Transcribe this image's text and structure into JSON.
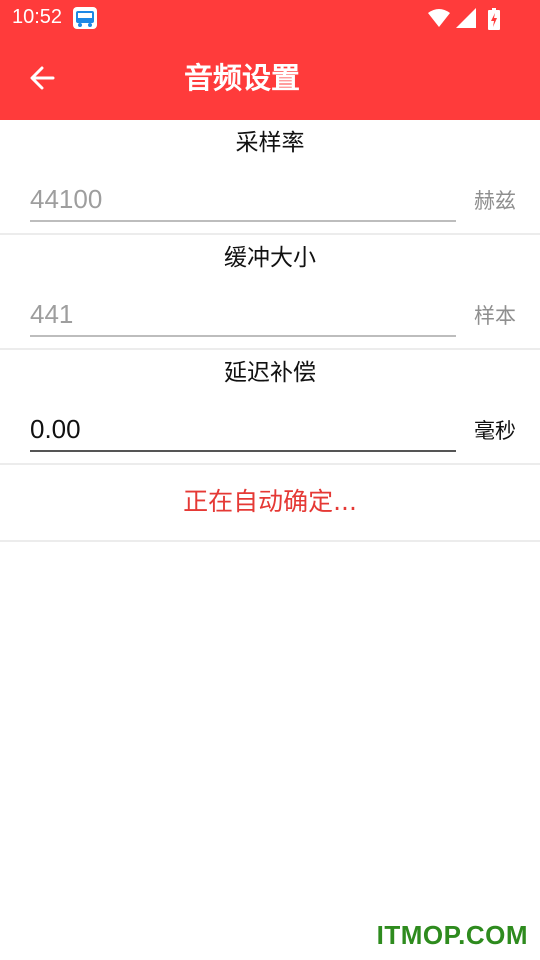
{
  "status_bar": {
    "time": "10:52"
  },
  "app_bar": {
    "title": "音频设置"
  },
  "settings": [
    {
      "label": "采样率",
      "value": "44100",
      "unit": "赫兹"
    },
    {
      "label": "缓冲大小",
      "value": "441",
      "unit": "样本"
    },
    {
      "label": "延迟补偿",
      "value": "0.00",
      "unit": "毫秒"
    }
  ],
  "auto_detect": {
    "text": "正在自动确定..."
  },
  "watermark": "ITMOP.COM",
  "colors": {
    "accent": "#ff3b3b",
    "auto_text": "#e53935",
    "watermark": "#2e8b1e"
  },
  "icons": [
    "back-arrow-icon",
    "wifi-icon",
    "signal-icon",
    "battery-icon",
    "notification-app-icon"
  ]
}
